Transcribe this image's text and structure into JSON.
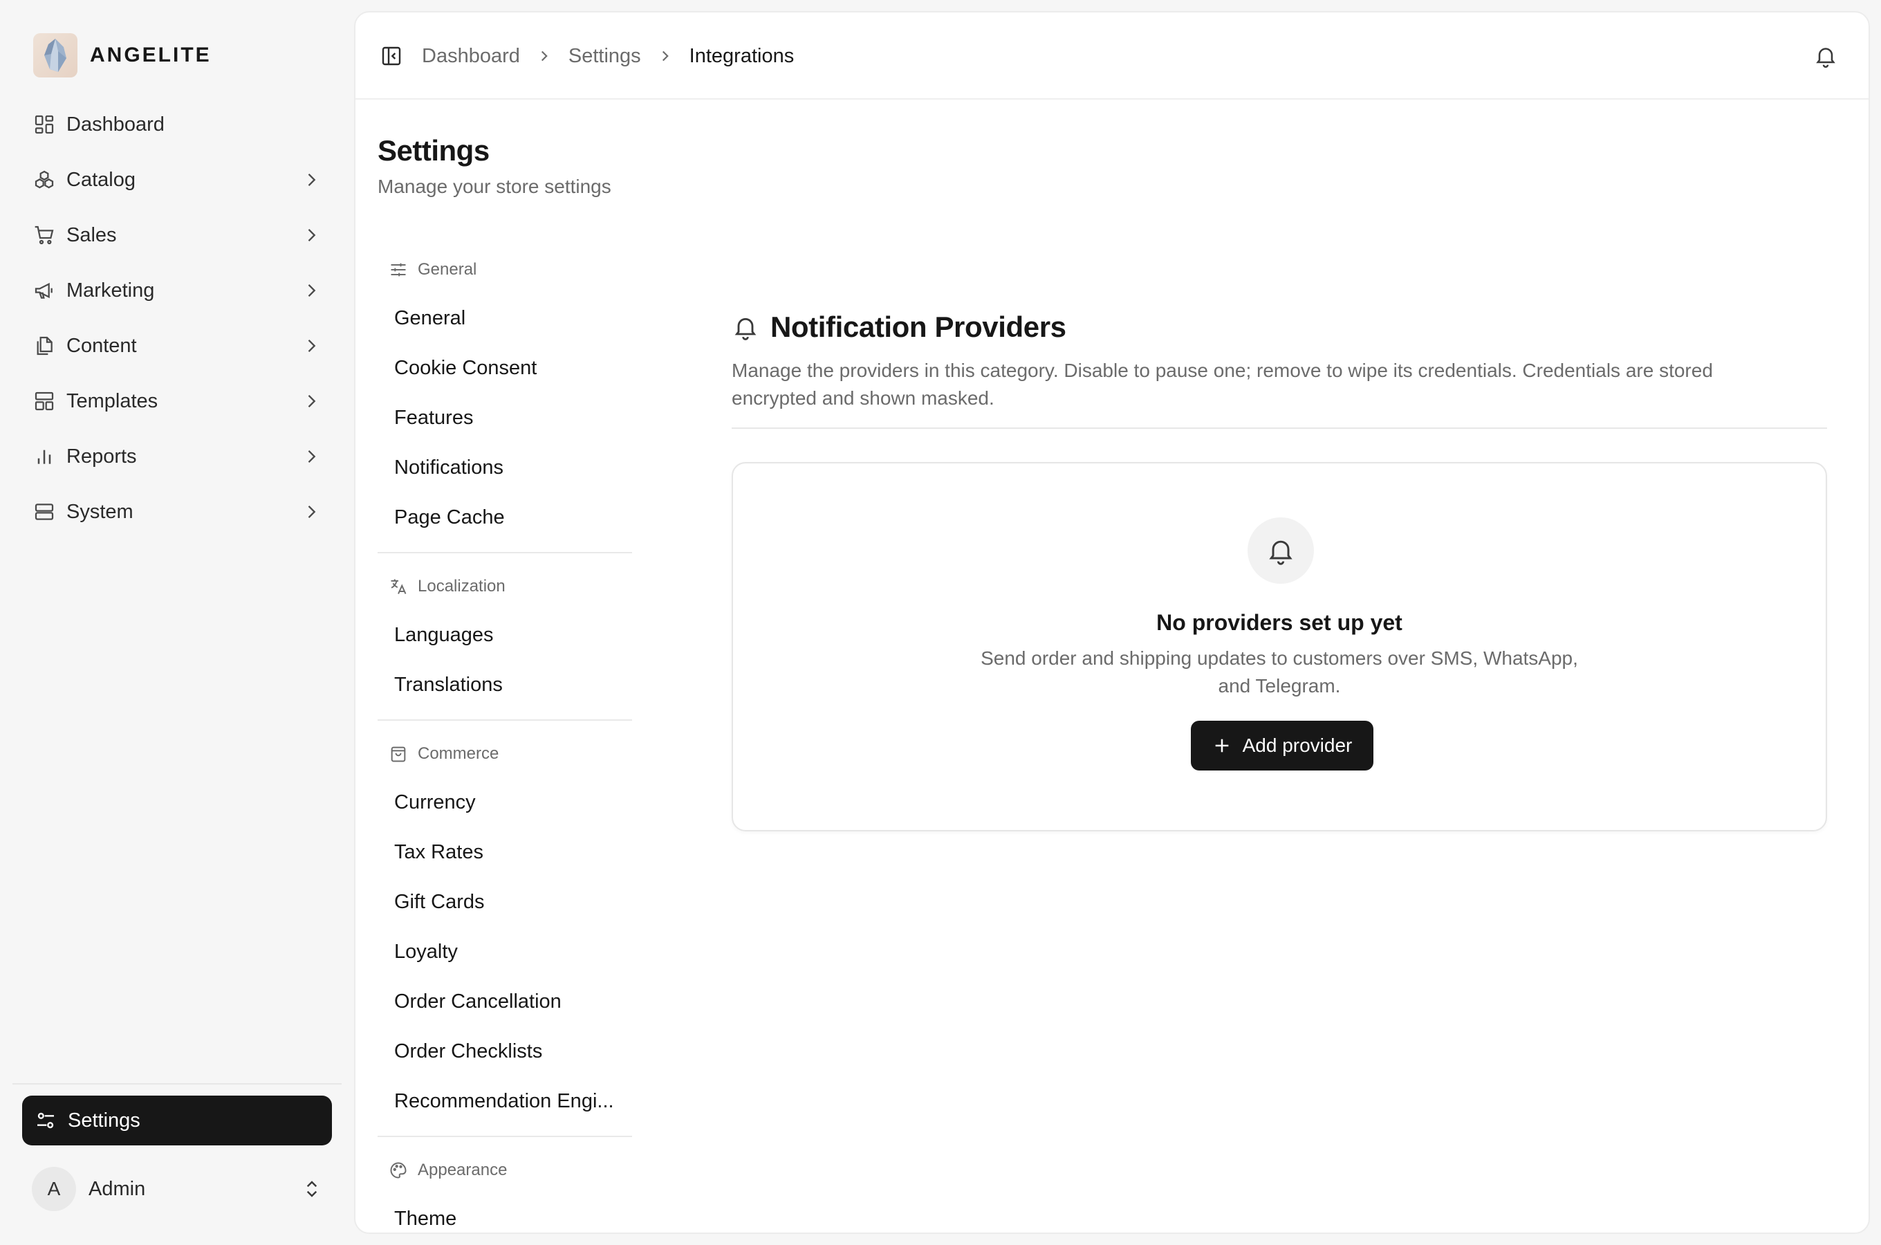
{
  "brand": {
    "name": "ANGELITE"
  },
  "sidebar": {
    "items": [
      {
        "label": "Dashboard",
        "icon": "dashboard-icon",
        "has_children": false
      },
      {
        "label": "Catalog",
        "icon": "catalog-icon",
        "has_children": true
      },
      {
        "label": "Sales",
        "icon": "cart-icon",
        "has_children": true
      },
      {
        "label": "Marketing",
        "icon": "megaphone-icon",
        "has_children": true
      },
      {
        "label": "Content",
        "icon": "documents-icon",
        "has_children": true
      },
      {
        "label": "Templates",
        "icon": "templates-icon",
        "has_children": true
      },
      {
        "label": "Reports",
        "icon": "bar-chart-icon",
        "has_children": true
      },
      {
        "label": "System",
        "icon": "server-icon",
        "has_children": true
      }
    ],
    "settings_label": "Settings",
    "user": {
      "initial": "A",
      "name": "Admin"
    }
  },
  "breadcrumb": {
    "items": [
      "Dashboard",
      "Settings",
      "Integrations"
    ]
  },
  "page": {
    "title": "Settings",
    "subtitle": "Manage your store settings"
  },
  "settings_menu": {
    "groups": [
      {
        "title": "General",
        "icon": "sliders-icon",
        "items": [
          "General",
          "Cookie Consent",
          "Features",
          "Notifications",
          "Page Cache"
        ]
      },
      {
        "title": "Localization",
        "icon": "translate-icon",
        "items": [
          "Languages",
          "Translations"
        ]
      },
      {
        "title": "Commerce",
        "icon": "shopping-bag-icon",
        "items": [
          "Currency",
          "Tax Rates",
          "Gift Cards",
          "Loyalty",
          "Order Cancellation",
          "Order Checklists",
          "Recommendation Engi..."
        ]
      },
      {
        "title": "Appearance",
        "icon": "palette-icon",
        "items": [
          "Theme"
        ]
      }
    ]
  },
  "section": {
    "title": "Notification Providers",
    "description": "Manage the providers in this category. Disable to pause one; remove to wipe its credentials. Credentials are stored encrypted and shown masked."
  },
  "empty_state": {
    "title": "No providers set up yet",
    "description": "Send order and shipping updates to customers over SMS, WhatsApp, and Telegram.",
    "button_label": "Add provider"
  },
  "colors": {
    "accent": "#171717",
    "background": "#f6f6f6",
    "panel": "#ffffff",
    "muted_text": "#6b6b6b"
  }
}
